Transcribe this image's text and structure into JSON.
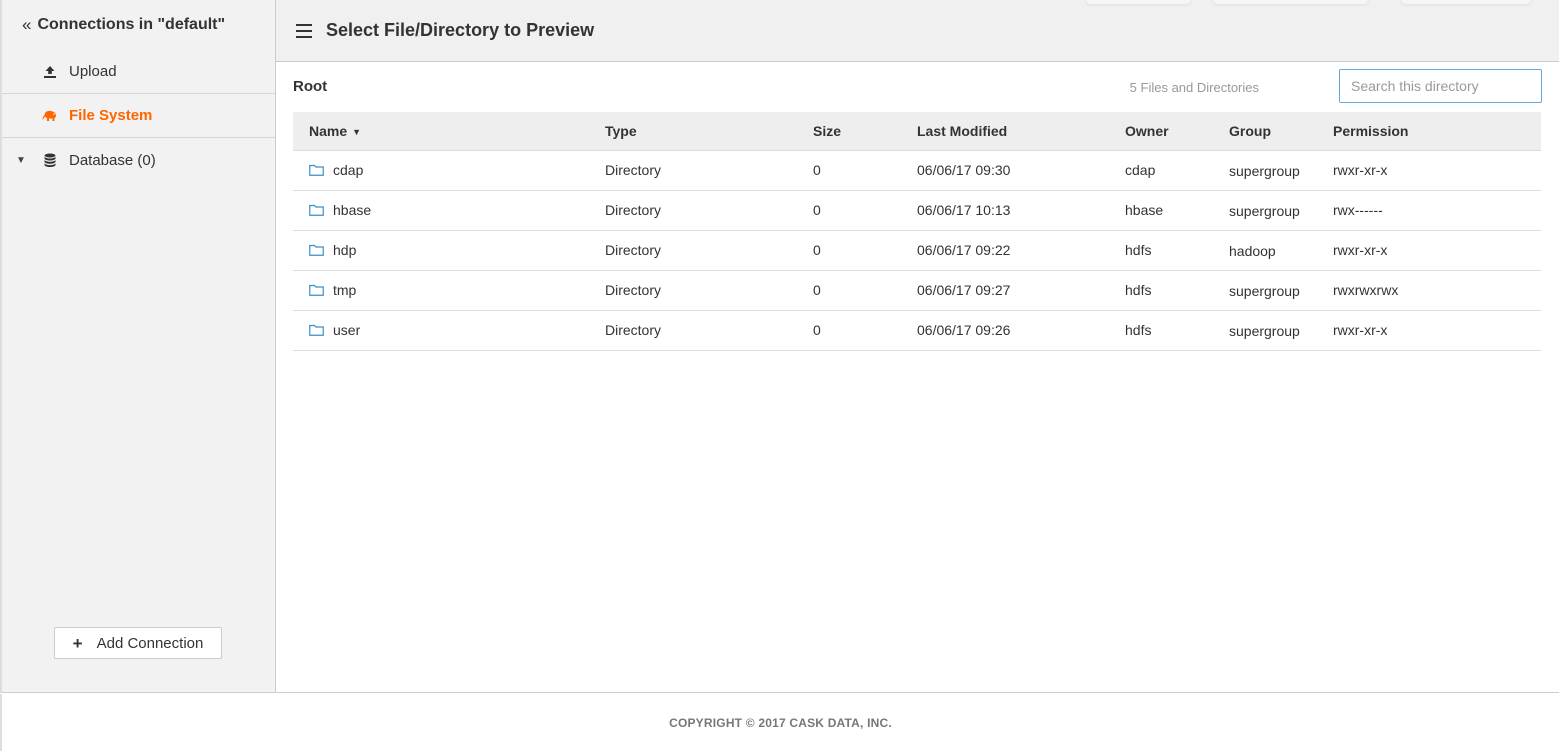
{
  "sidebar": {
    "title": "Connections in \"default\"",
    "collapse_glyph": "«",
    "items": [
      {
        "label": "Upload",
        "icon": "upload-icon"
      },
      {
        "label": "File System",
        "icon": "hdfs-elephant-icon",
        "active": true
      },
      {
        "label": "Database (0)",
        "icon": "database-icon"
      }
    ],
    "add_connection_label": "Add Connection"
  },
  "header": {
    "title": "Select File/Directory to Preview"
  },
  "toolbar": {
    "breadcrumb": "Root",
    "count_text": "5 Files and Directories",
    "search_placeholder": "Search this directory"
  },
  "table": {
    "columns": [
      "Name",
      "Type",
      "Size",
      "Last Modified",
      "Owner",
      "Group",
      "Permission"
    ],
    "rows": [
      {
        "name": "cdap",
        "type": "Directory",
        "size": "0",
        "modified": "06/06/17 09:30",
        "owner": "cdap",
        "group": "supergroup",
        "permission": "rwxr-xr-x"
      },
      {
        "name": "hbase",
        "type": "Directory",
        "size": "0",
        "modified": "06/06/17 10:13",
        "owner": "hbase",
        "group": "supergroup",
        "permission": "rwx------"
      },
      {
        "name": "hdp",
        "type": "Directory",
        "size": "0",
        "modified": "06/06/17 09:22",
        "owner": "hdfs",
        "group": "hadoop",
        "permission": "rwxr-xr-x"
      },
      {
        "name": "tmp",
        "type": "Directory",
        "size": "0",
        "modified": "06/06/17 09:27",
        "owner": "hdfs",
        "group": "supergroup",
        "permission": "rwxrwxrwx"
      },
      {
        "name": "user",
        "type": "Directory",
        "size": "0",
        "modified": "06/06/17 09:26",
        "owner": "hdfs",
        "group": "supergroup",
        "permission": "rwxr-xr-x"
      }
    ]
  },
  "footer": {
    "copyright": "COPYRIGHT © 2017 CASK DATA, INC."
  },
  "colors": {
    "accent": "#ff6600",
    "folder_icon": "#3a8fc7",
    "search_border": "#66aadd"
  }
}
